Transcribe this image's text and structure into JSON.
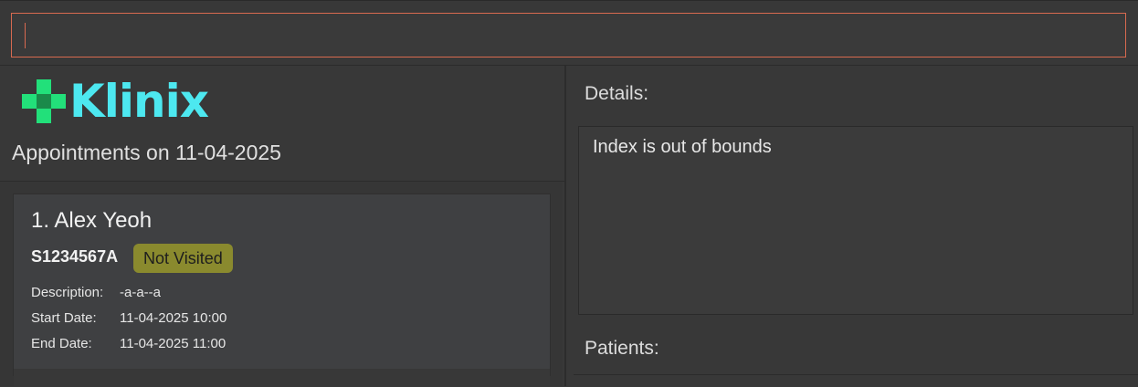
{
  "command_box": {
    "value": ""
  },
  "app": {
    "logo_text": "Klinix",
    "logo_icon": "medical-cross-icon",
    "accent_color": "#4de8f0",
    "cross_color": "#22e07a"
  },
  "appointments": {
    "heading": "Appointments on 11-04-2025",
    "items": [
      {
        "name": "1. Alex Yeoh",
        "nric": "S1234567A",
        "status": "Not Visited",
        "status_color": "#8a8a2e",
        "description_label": "Description:",
        "description": "-a-a--a",
        "start_label": "Start Date:",
        "start": "11-04-2025 10:00",
        "end_label": "End Date:",
        "end": "11-04-2025 11:00"
      }
    ]
  },
  "details": {
    "label": "Details:",
    "message": "Index is out of bounds"
  },
  "patients": {
    "label": "Patients:"
  }
}
